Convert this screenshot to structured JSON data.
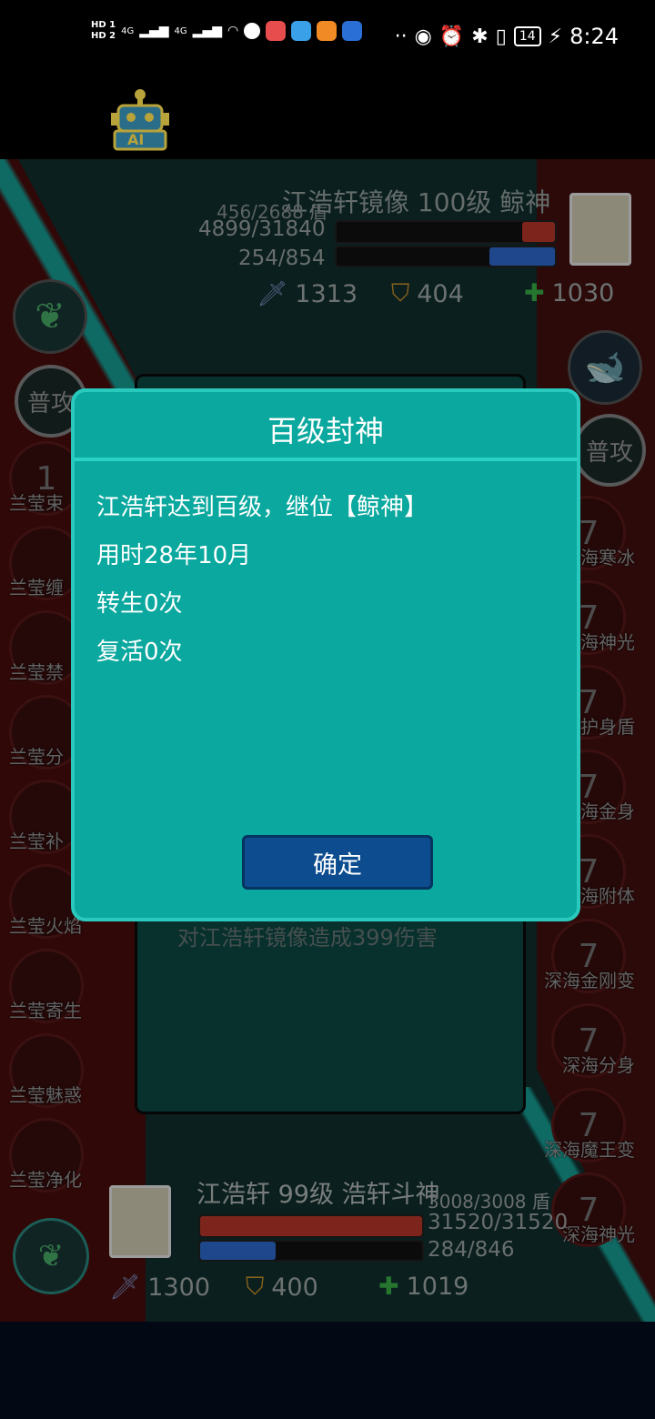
{
  "status_bar": {
    "hd1": "HD 1",
    "hd2": "HD 2",
    "signal1": "4G",
    "signal2": "4G",
    "battery": "14",
    "time": "8:24"
  },
  "ai_badge": "AI",
  "enemy": {
    "name": "江浩轩镜像 100级 鲸神",
    "shield": "456/2688 盾",
    "hp": "4899/31840",
    "mp": "254/854",
    "hp_fraction": 0.15,
    "mp_fraction": 0.3,
    "attack": "1313",
    "defense": "404",
    "heal": "1030",
    "basic_attack": "普攻",
    "skills": [
      {
        "level": "7",
        "label": "深海寒冰"
      },
      {
        "level": "7",
        "label": "深海神光"
      },
      {
        "level": "7",
        "label": "深海护身盾"
      },
      {
        "level": "7",
        "label": "深海金身"
      },
      {
        "level": "7",
        "label": "深海附体"
      },
      {
        "level": "7",
        "label": "深海金刚变"
      },
      {
        "level": "7",
        "label": "深海分身"
      },
      {
        "level": "7",
        "label": "深海魔王变"
      },
      {
        "level": "7",
        "label": "深海神光"
      }
    ]
  },
  "player": {
    "name": "江浩轩 99级 浩轩斗神",
    "shield": "3008/3008 盾",
    "hp": "31520/31520",
    "mp": "284/846",
    "hp_fraction": 1.0,
    "mp_fraction": 0.34,
    "attack": "1300",
    "defense": "400",
    "heal": "1019",
    "basic_attack": "普攻",
    "skills": [
      {
        "level": "1",
        "label": "兰莹束"
      },
      {
        "level": "",
        "label": "兰莹缠"
      },
      {
        "level": "",
        "label": "兰莹禁"
      },
      {
        "level": "",
        "label": "兰莹分"
      },
      {
        "level": "",
        "label": "兰莹补"
      },
      {
        "level": "",
        "label": "兰莹火焰"
      },
      {
        "level": "",
        "label": "兰莹寄生"
      },
      {
        "level": "",
        "label": "兰莹魅惑"
      },
      {
        "level": "",
        "label": "兰莹净化"
      }
    ]
  },
  "battle_log": "对江浩轩镜像造成399伤害",
  "dialog": {
    "title": "百级封神",
    "lines": [
      "江浩轩达到百级，继位【鲸神】",
      "用时28年10月",
      "转生0次",
      "复活0次"
    ],
    "confirm": "确定"
  },
  "colors": {
    "dialog_bg": "#0aa89e",
    "dialog_border": "#29c9bd",
    "confirm_bg": "#0c4c8f",
    "hp": "#c0392b",
    "mp": "#2e6fd6"
  }
}
